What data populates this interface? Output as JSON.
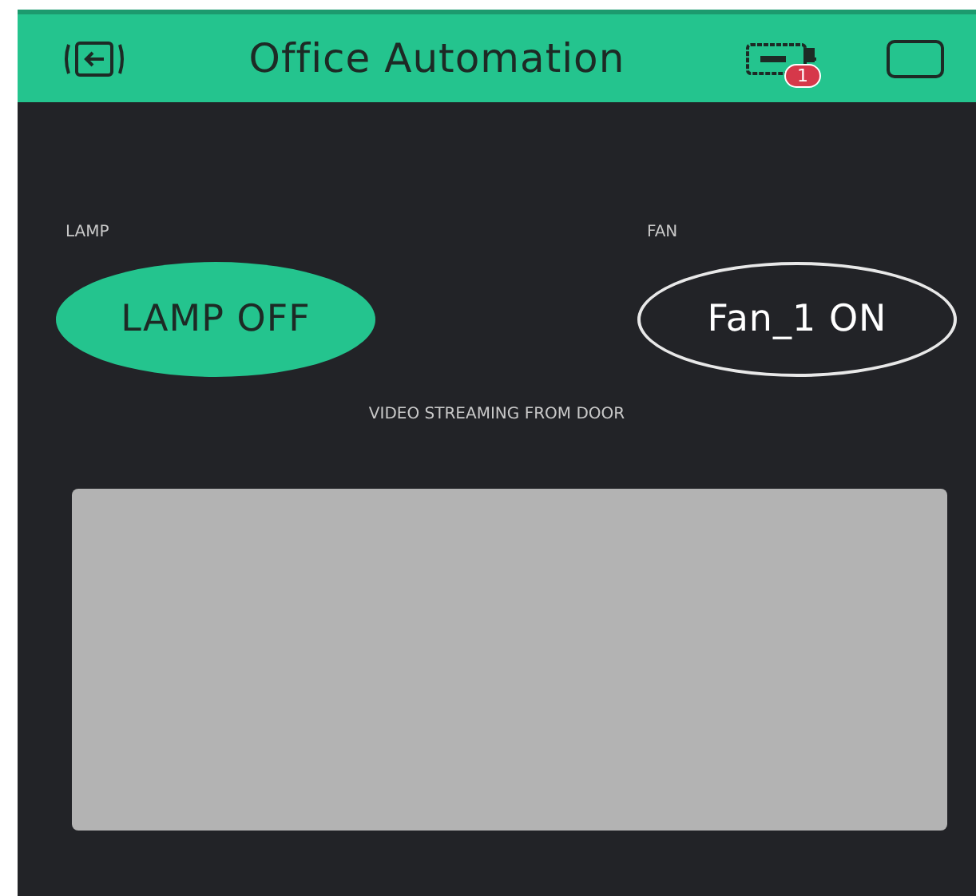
{
  "header": {
    "title": "Office Automation",
    "device_badge": "1"
  },
  "widgets": [
    {
      "kind": "button",
      "label": "LAMP",
      "text": "LAMP OFF",
      "on": true
    },
    {
      "kind": "button",
      "label": "FAN",
      "text": "Fan_1 ON",
      "on": false
    },
    {
      "kind": "video",
      "label": "VIDEO STREAMING FROM DOOR"
    }
  ]
}
